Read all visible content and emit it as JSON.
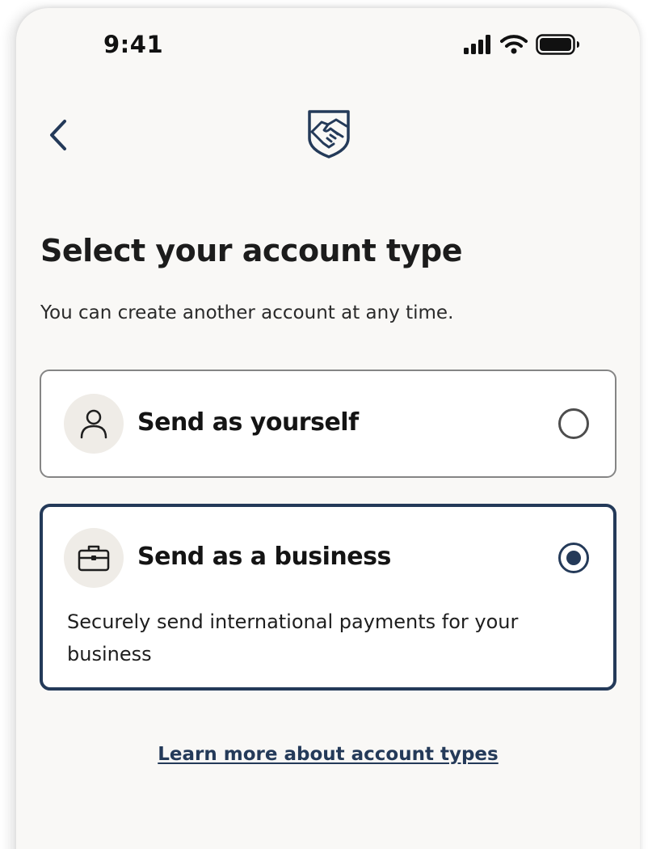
{
  "status_bar": {
    "time": "9:41",
    "icons": [
      "cellular-signal-icon",
      "wifi-icon",
      "battery-icon"
    ]
  },
  "header": {
    "back_icon": "chevron-left-icon",
    "logo_icon": "handshake-shield-logo"
  },
  "page": {
    "title": "Select your account type",
    "subtitle": "You can create another account at any time."
  },
  "options": [
    {
      "label": "Send as yourself",
      "icon": "person-icon",
      "selected": false
    },
    {
      "label": "Send as a business",
      "icon": "briefcase-icon",
      "selected": true,
      "description": "Securely send international payments for your business"
    }
  ],
  "footer": {
    "learn_more": "Learn more about account types"
  },
  "colors": {
    "background": "#f9f8f6",
    "accent": "#243a59",
    "icon_circle": "#efece7",
    "text": "#1c1c1c"
  }
}
